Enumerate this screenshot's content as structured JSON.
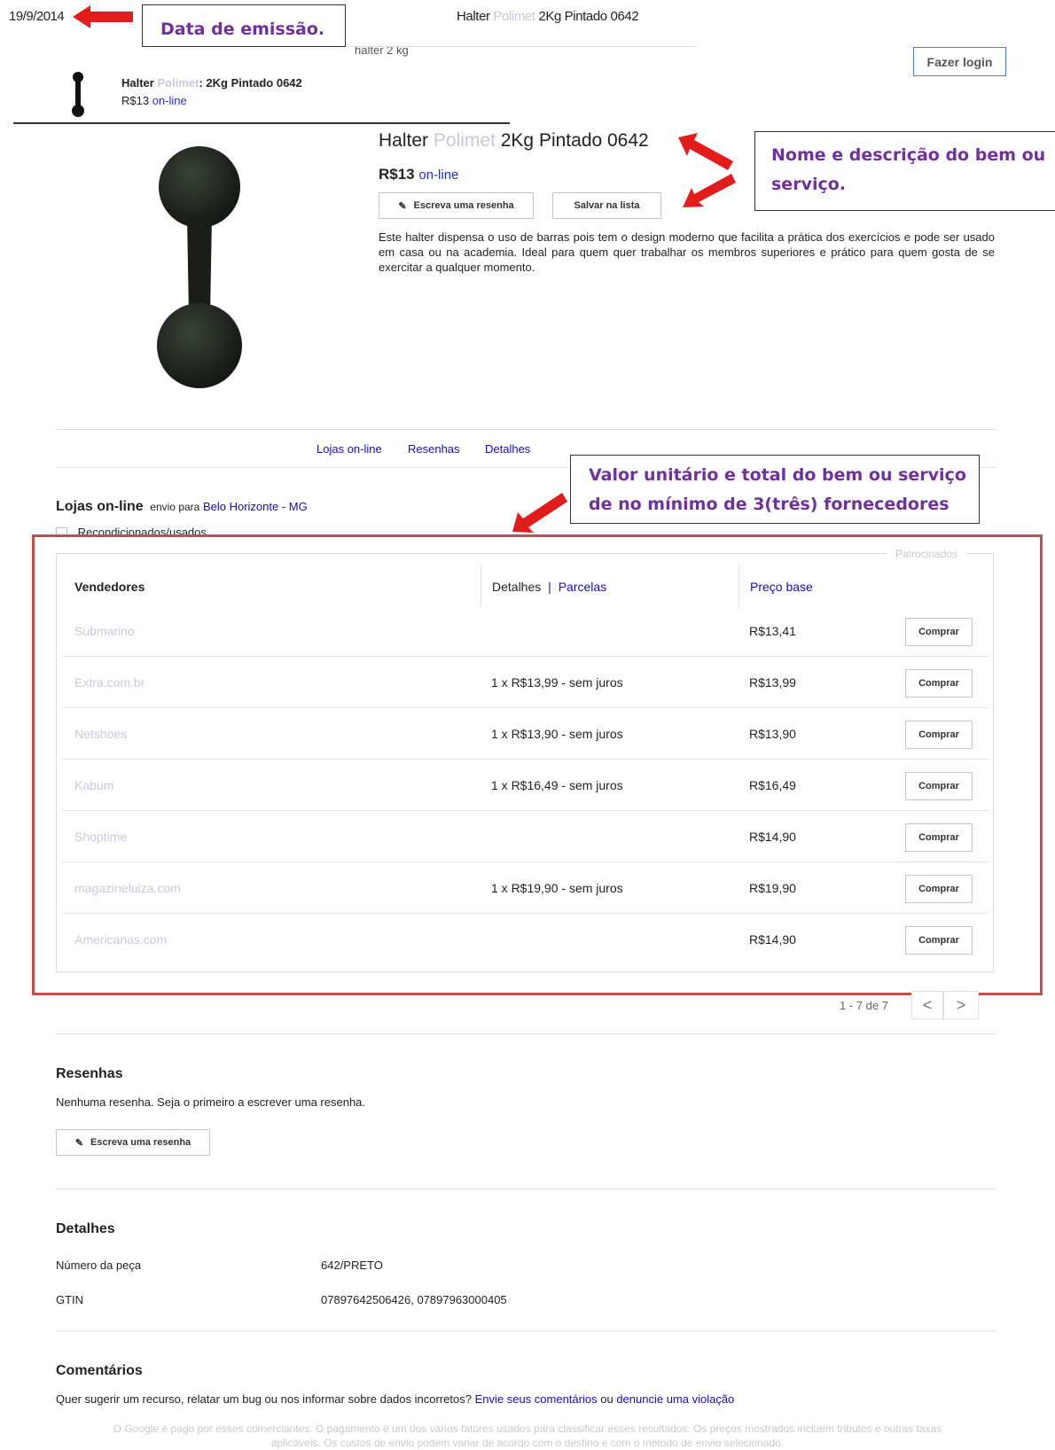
{
  "annotations": {
    "issue_date": "19/9/2014",
    "issue_date_label": "Data de emissão.",
    "name_label": "Nome e descrição do bem ou serviço.",
    "value_label_line1": "Valor unitário e total do bem ou serviço",
    "value_label_line2": "de no mínimo de 3(três) fornecedores"
  },
  "header": {
    "title_prefix": "Halter",
    "title_faded": "Polimet",
    "title_suffix": "2Kg Pintado 0642",
    "search_text": "halter 2 kg",
    "login_label": "Fazer login"
  },
  "suggestion": {
    "title_prefix": "Halter",
    "title_faded": "Polimet",
    "title_suffix": ": 2Kg Pintado 0642",
    "price": "R$13",
    "price_note": "on-line"
  },
  "product": {
    "title_prefix": "Halter",
    "title_faded": "Polimet",
    "title_suffix": "2Kg Pintado 0642",
    "price": "R$13",
    "price_note": "on-line",
    "review_button": "Escreva uma resenha",
    "save_button": "Salvar na lista",
    "description": "Este halter dispensa o uso de barras pois tem o design moderno que facilita a prática dos exercícios e pode ser usado em casa ou na academia. Ideal para quem quer trabalhar os membros superiores e prático para quem gosta de se exercitar a qualquer momento."
  },
  "tabs": [
    "Lojas on-line",
    "Resenhas",
    "Detalhes"
  ],
  "stores": {
    "title": "Lojas on-line",
    "ship_prefix": "envio para",
    "ship_location": "Belo Horizonte - MG",
    "refurb_label": "Recondicionados/usados",
    "sponsored": "Patrocinados",
    "col_sellers": "Vendedores",
    "col_details": "Detalhes",
    "col_sep": "|",
    "col_installments": "Parcelas",
    "col_price": "Preço base",
    "buy_label": "Comprar",
    "rows": [
      {
        "seller": "Submarino",
        "details": "",
        "price": "R$13,41"
      },
      {
        "seller": "Extra.com.br",
        "details": "1 x R$13,99 - sem juros",
        "price": "R$13,99"
      },
      {
        "seller": "Netshoes",
        "details": "1 x R$13,90 - sem juros",
        "price": "R$13,90"
      },
      {
        "seller": "Kabum",
        "details": "1 x R$16,49 - sem juros",
        "price": "R$16,49"
      },
      {
        "seller": "Shoptime",
        "details": "",
        "price": "R$14,90"
      },
      {
        "seller": "magazineluiza.com",
        "details": "1 x R$19,90 - sem juros",
        "price": "R$19,90"
      },
      {
        "seller": "Americanas.com",
        "details": "",
        "price": "R$14,90"
      }
    ],
    "pagination": "1 - 7 de 7",
    "prev": "<",
    "next": ">"
  },
  "reviews": {
    "title": "Resenhas",
    "empty": "Nenhuma resenha. Seja o primeiro a escrever uma resenha.",
    "button": "Escreva uma resenha"
  },
  "details": {
    "title": "Detalhes",
    "rows": [
      {
        "label": "Número da peça",
        "value": "642/PRETO"
      },
      {
        "label": "GTIN",
        "value": "07897642506426, 07897963000405"
      }
    ]
  },
  "comments": {
    "title": "Comentários",
    "text": "Quer sugerir um recurso, relatar um bug ou nos informar sobre dados incorretos?",
    "link1": "Envie seus comentários",
    "connector": "ou",
    "link2": "denuncie uma violação"
  },
  "footer": {
    "line1": "O Google é pago por esses comerciantes. O pagamento é um dos vários fatores usados para classificar esses resultados. Os preços mostrados incluem tributos e outras taxas",
    "line2": "aplicáveis. Os custos de envio podem variar de acordo com o destino e com o método de envio selecionado."
  },
  "colors": {
    "annotation_red": "#e21b1b",
    "callout_text": "#7030a0",
    "box_red": "#c0504d",
    "link_blue": "#1a0dab"
  }
}
